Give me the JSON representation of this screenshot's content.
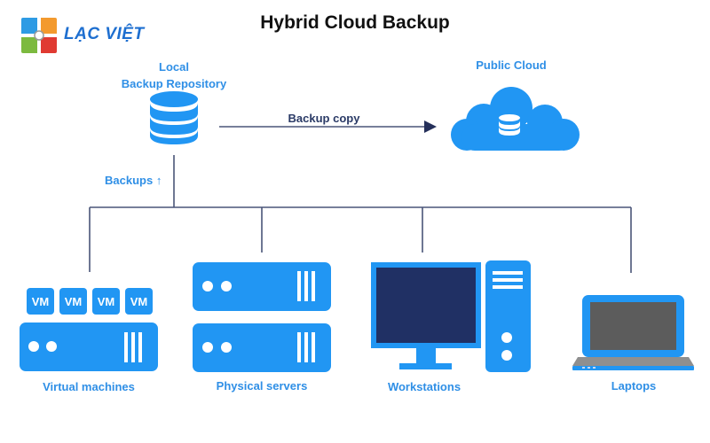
{
  "title": "Hybrid Cloud Backup",
  "logo": {
    "text": "LẠC VIỆT",
    "icon": "four-petal-logo-icon",
    "colors": [
      "#2e9be4",
      "#f39a2e",
      "#7cba3f",
      "#e03a32"
    ]
  },
  "nodes": {
    "local_repo": {
      "label_line1": "Local",
      "label_line2": "Backup Repository",
      "icon": "database-icon"
    },
    "public_cloud": {
      "label": "Public Cloud",
      "icon": "cloud-database-icon"
    },
    "virtual_machines": {
      "label": "Virtual machines",
      "vm_labels": [
        "VM",
        "VM",
        "VM",
        "VM"
      ],
      "icon": "server-icon"
    },
    "physical_servers": {
      "label": "Physical servers",
      "icon": "server-stack-icon"
    },
    "workstations": {
      "label": "Workstations",
      "icon": "desktop-computer-icon"
    },
    "laptops": {
      "label": "Laptops",
      "icon": "laptop-icon"
    }
  },
  "edges": {
    "backup_copy": {
      "label": "Backup copy",
      "from": "Local Backup Repository",
      "to": "Public Cloud"
    },
    "backups": {
      "label": "Backups",
      "arrow": "↑"
    }
  },
  "colors": {
    "accent_blue": "#2196f3",
    "label_blue": "#2f8fe6",
    "line_navy": "#2a3a66",
    "screen_navy": "#203064",
    "laptop_screen": "#5c5c5c"
  }
}
